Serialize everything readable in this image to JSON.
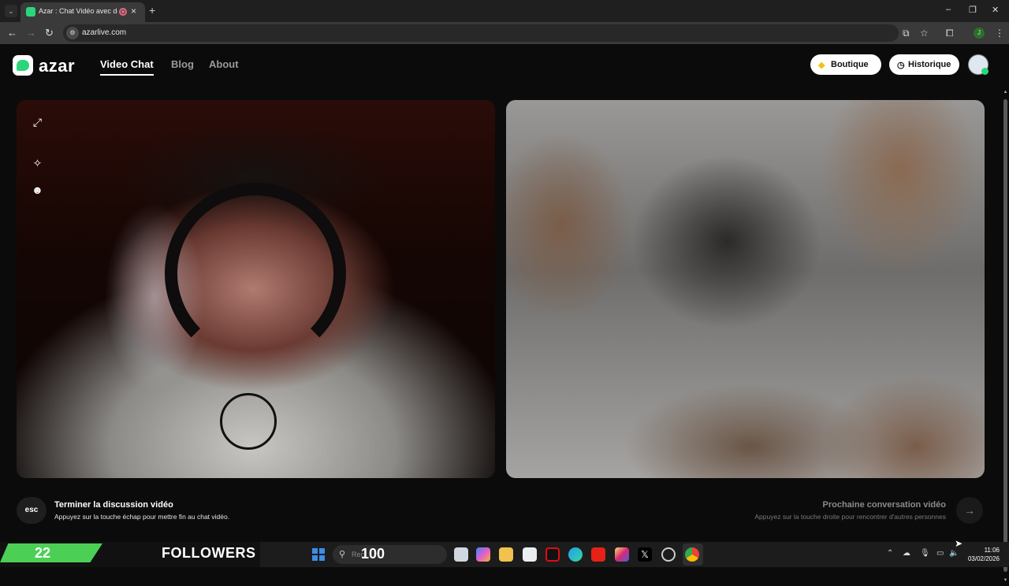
{
  "browser": {
    "tab_title": "Azar : Chat Vidéo avec de n",
    "url": "azarlive.com",
    "profile_initial": "J"
  },
  "site": {
    "logo_text": "azar",
    "nav": [
      "Video Chat",
      "Blog",
      "About"
    ],
    "active_nav": "Video Chat",
    "boutique_label": "Boutique",
    "historique_label": "Historique"
  },
  "footer": {
    "esc_label": "esc",
    "end_title": "Terminer la discussion vidéo",
    "end_subtitle": "Appuyez sur la touche échap pour mettre fin au chat vidéo.",
    "next_title": "Prochaine conversation vidéo",
    "next_subtitle": "Appuyez sur la touche droite pour rencontrer d'autres personnes"
  },
  "overlay": {
    "followers_count": "22",
    "followers_label": "FOLLOWERS",
    "search_placeholder": "Rec",
    "search_count": "100"
  },
  "taskbar": {
    "time": "11:06",
    "date": "03/02/2026",
    "apps": [
      "file-explorer-icon",
      "copilot-icon",
      "folder-icon",
      "store-icon",
      "netflix-icon",
      "edge-icon",
      "youtube-icon",
      "instagram-icon",
      "x-icon",
      "app-icon",
      "chrome-icon"
    ]
  },
  "colors": {
    "accent_green": "#2bd67b",
    "followers_green": "#4ccf55"
  }
}
